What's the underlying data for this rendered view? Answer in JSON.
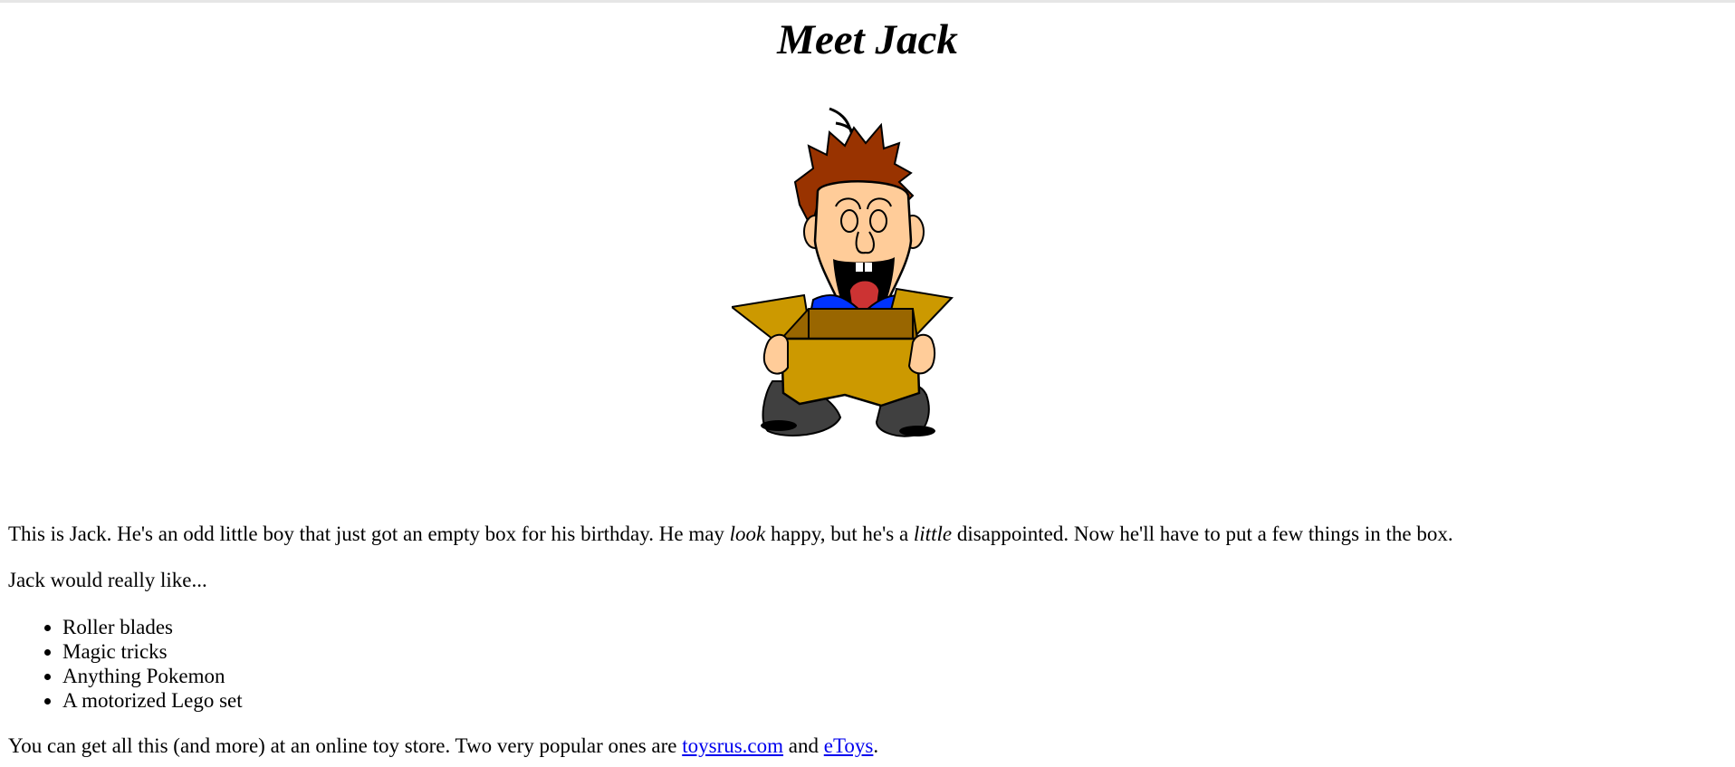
{
  "page": {
    "title": "Meet Jack",
    "image_alt": "Jack holding an empty box",
    "intro": {
      "part1": "This is Jack. He's an odd little boy that just got an empty box for his birthday. He may ",
      "em1": "look",
      "part2": " happy, but he's a ",
      "em2": "little",
      "part3": " disappointed. Now he'll have to put a few things in the box."
    },
    "wish_intro": "Jack would really like...",
    "wishes": [
      "Roller blades",
      "Magic tricks",
      "Anything Pokemon",
      "A motorized Lego set"
    ],
    "stores": {
      "before": "You can get all this (and more) at an online toy store. Two very popular ones are ",
      "link1": "toysrus.com",
      "between": " and ",
      "link2": "eToys",
      "after": "."
    }
  },
  "colors": {
    "link": "#0000ee",
    "box": "#cc9900",
    "box_inner": "#996600",
    "hair": "#993300",
    "skin": "#ffcc99",
    "shirt": "#0033ff",
    "pants": "#404040"
  }
}
